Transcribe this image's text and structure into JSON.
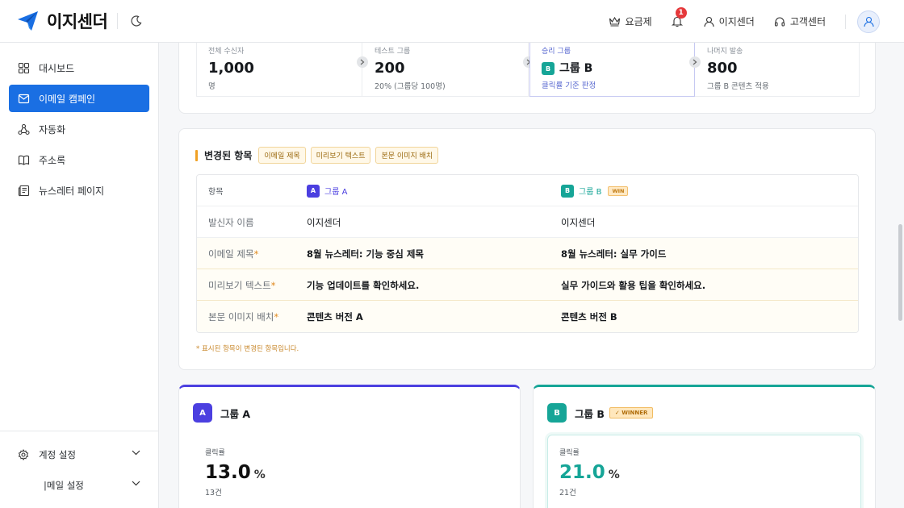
{
  "header": {
    "logo_text": "이지센더",
    "pricing": "요금제",
    "notif_count": "1",
    "user_name": "이지센더",
    "support": "고객센터"
  },
  "sidebar": {
    "items": [
      {
        "label": "대시보드",
        "icon": "dashboard-icon"
      },
      {
        "label": "이메일 캠페인",
        "icon": "mail-icon"
      },
      {
        "label": "자동화",
        "icon": "automation-icon"
      },
      {
        "label": "주소록",
        "icon": "book-icon"
      },
      {
        "label": "뉴스레터 페이지",
        "icon": "newsletter-icon"
      }
    ],
    "settings": [
      {
        "label": "계정 설정"
      },
      {
        "label": "|메일 설정"
      }
    ]
  },
  "flow": {
    "total_label": "전체 수신자",
    "total_value": "1,000",
    "total_sub": "명",
    "test_label": "테스트 그룹",
    "test_value": "200",
    "test_sub": "20% (그룹당 100명)",
    "winner_label": "승리 그룹",
    "winner_badge": "B",
    "winner_value": "그룹 B",
    "winner_sub": "클릭률 기준 판정",
    "rest_label": "나머지 발송",
    "rest_value": "800",
    "rest_sub": "그룹 B 콘텐츠 적용"
  },
  "changes": {
    "title": "변경된 항목",
    "tags": [
      "이메일 제목",
      "미리보기 텍스트",
      "본문 이미지 배치"
    ],
    "col_item": "항목",
    "col_a_badge": "A",
    "col_a": "그룹 A",
    "col_b_badge": "B",
    "col_b": "그룹 B",
    "win_pill": "WIN",
    "rows": [
      {
        "label": "발신자 이름",
        "star": "",
        "a": "이지센더",
        "b": "이지센더"
      },
      {
        "label": "이메일 제목",
        "star": "*",
        "a": "8월 뉴스레터: 기능 중심 제목",
        "b": "8월 뉴스레터: 실무 가이드"
      },
      {
        "label": "미리보기 텍스트",
        "star": "*",
        "a": "기능 업데이트를 확인하세요.",
        "b": "실무 가이드와 활용 팁을 확인하세요."
      },
      {
        "label": "본문 이미지 배치",
        "star": "*",
        "a": "콘텐츠 버전 A",
        "b": "콘텐츠 버전 B"
      }
    ],
    "note": "* 표시된 항목이 변경된 항목입니다."
  },
  "groups": {
    "a": {
      "badge": "A",
      "name": "그룹 A",
      "metric_label": "클릭률",
      "value": "13.0",
      "unit": "%",
      "count": "13건"
    },
    "b": {
      "badge": "B",
      "name": "그룹 B",
      "winner": "✓ WINNER",
      "metric_label": "클릭률",
      "value": "21.0",
      "unit": "%",
      "count": "21건"
    }
  },
  "colors": {
    "primary": "#1a6fe3",
    "group_a": "#4b3fe0",
    "group_b": "#16a597",
    "accent": "#f0a125"
  }
}
